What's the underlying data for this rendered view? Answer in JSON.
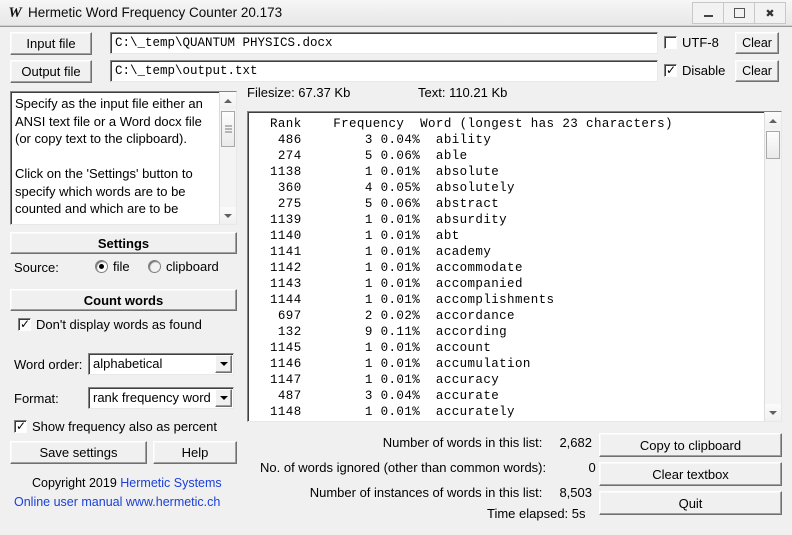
{
  "window": {
    "title": "Hermetic Word Frequency Counter 20.173",
    "icon": "W",
    "buttons": {
      "minimize": "minimize-icon",
      "maximize": "maximize-icon",
      "close": "close-icon"
    }
  },
  "toolbar": {
    "input_file_button": "Input file",
    "output_file_button": "Output file",
    "input_file_value": "C:\\_temp\\QUANTUM PHYSICS.docx",
    "output_file_value": "C:\\_temp\\output.txt",
    "utf8_label": "UTF-8",
    "utf8_checked": false,
    "disable_label": "Disable",
    "disable_checked": true,
    "clear_input_label": "Clear",
    "clear_output_label": "Clear"
  },
  "help_panel": {
    "text": "Specify as the input file either an ANSI text file or a Word docx file (or copy text to the clipboard).\n\nClick on the 'Settings' button to specify which words are to be counted and which are to be"
  },
  "left_controls": {
    "settings_button": "Settings",
    "source_label": "Source:",
    "source_file_label": "file",
    "source_clipboard_label": "clipboard",
    "source_selected": "file",
    "count_words_button": "Count words",
    "dont_display_label": "Don't display words as found",
    "dont_display_checked": true,
    "word_order_label": "Word order:",
    "word_order_value": "alphabetical",
    "format_label": "Format:",
    "format_value": "rank frequency word",
    "show_percent_label": "Show frequency also as percent",
    "show_percent_checked": true,
    "save_settings_button": "Save settings",
    "help_button": "Help"
  },
  "footer": {
    "copyright": "Copyright 2019",
    "company": "Hermetic Systems",
    "manual_link": "Online user manual",
    "website": "www.hermetic.ch"
  },
  "file_info": {
    "filesize_label": "Filesize: 67.37 Kb",
    "text_label": "Text: 110.21 Kb"
  },
  "word_list": {
    "header": "Rank    Frequency  Word (longest has 23 characters)",
    "rows": [
      " 486        3 0.04%  ability",
      " 274        5 0.06%  able",
      "1138        1 0.01%  absolute",
      " 360        4 0.05%  absolutely",
      " 275        5 0.06%  abstract",
      "1139        1 0.01%  absurdity",
      "1140        1 0.01%  abt",
      "1141        1 0.01%  academy",
      "1142        1 0.01%  accommodate",
      "1143        1 0.01%  accompanied",
      "1144        1 0.01%  accomplishments",
      " 697        2 0.02%  accordance",
      " 132        9 0.11%  according",
      "1145        1 0.01%  account",
      "1146        1 0.01%  accumulation",
      "1147        1 0.01%  accuracy",
      " 487        3 0.04%  accurate",
      "1148        1 0.01%  accurately"
    ]
  },
  "stats": {
    "words_in_list_label": "Number of words in this list:",
    "words_in_list_value": "2,682",
    "words_ignored_label": "No. of words ignored (other than common words):",
    "words_ignored_value": "0",
    "instances_label": "Number of instances of words in this list:",
    "instances_value": "8,503",
    "time_elapsed": "Time elapsed: 5s"
  },
  "right_buttons": {
    "copy_to_clipboard": "Copy to clipboard",
    "clear_textbox": "Clear textbox",
    "quit": "Quit"
  },
  "colors": {
    "link": "#1a3fd8",
    "face": "#f0f0f0",
    "window": "#ffffff"
  }
}
